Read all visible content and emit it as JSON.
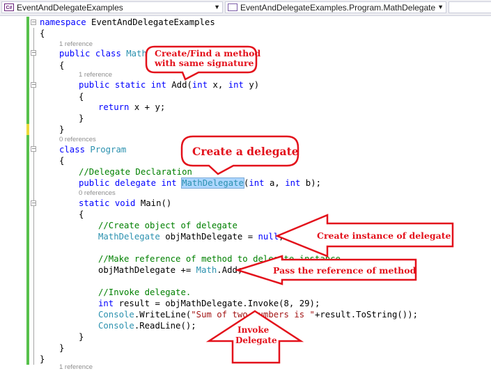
{
  "toolbar": {
    "project_dropdown": {
      "icon": "csharp-project-icon",
      "icon_text": "C#",
      "value": "EventAndDelegateExamples"
    },
    "member_dropdown": {
      "icon": "delegate-member-icon",
      "value": "EventAndDelegateExamples.Program.MathDelegate"
    }
  },
  "code": {
    "l1_ns_kw": "namespace",
    "l1_ns_name": " EventAndDelegateExamples",
    "l2": "{",
    "lens1": "1 reference",
    "l3_public": "public",
    "l3_class": " class",
    "l3_name": " Math",
    "l4": "{",
    "lens2": "1 reference",
    "l5_public": "public",
    "l5_static": " static",
    "l5_int": " int",
    "l5_add": " Add(",
    "l5_int2": "int",
    "l5_x": " x, ",
    "l5_int3": "int",
    "l5_y": " y)",
    "l6": "{",
    "l7_return": "return",
    "l7_rest": " x + y;",
    "l8": "}",
    "l9": "}",
    "lens3": "0 references",
    "l10_class": "class",
    "l10_name": " Program",
    "l11": "{",
    "l12_comment": "//Delegate Declaration",
    "l13_public": "public",
    "l13_delegate": " delegate",
    "l13_int": " int",
    "l13_name": "MathDelegate",
    "l13_open": "(",
    "l13_int2": "int",
    "l13_a": " a, ",
    "l13_int3": "int",
    "l13_b": " b);",
    "lens4": "0 references",
    "l14_static": "static",
    "l14_void": " void",
    "l14_main": " Main()",
    "l15": "{",
    "l16_comment": "//Create object of delegate",
    "l17_type": "MathDelegate",
    "l17_rest": " objMathDelegate = ",
    "l17_null": "null",
    "l17_end": ";",
    "l18_comment": "//Make reference of method to delegate instance",
    "l19_a": "objMathDelegate += ",
    "l19_type": "Math",
    "l19_b": ".Add;",
    "l20_comment": "//Invoke delegate.",
    "l21_int": "int",
    "l21_rest": " result = objMathDelegate.Invoke(8, 29);",
    "l22_type": "Console",
    "l22_a": ".WriteLine(",
    "l22_str": "\"Sum of two numbers is \"",
    "l22_b": "+result.ToString());",
    "l23_type": "Console",
    "l23_rest": ".ReadLine();",
    "l24": "}",
    "l25": "}",
    "l26": "}",
    "lens5": "1 reference"
  },
  "annotations": {
    "bubble1_line1": "Create/Find a method",
    "bubble1_line2": "with same signature",
    "bubble2": "Create a delegate",
    "arrow1": "Create instance of delegate",
    "arrow2": "Pass the reference of method",
    "arrow3_line1": "Invoke",
    "arrow3_line2": "Delegate"
  },
  "colors": {
    "keyword": "#0000ff",
    "type": "#2b91af",
    "comment": "#008000",
    "string": "#a31515",
    "annotation_red": "#e3111b",
    "change_bar_green": "#57c14c",
    "change_bar_yellow": "#ecd93a"
  }
}
